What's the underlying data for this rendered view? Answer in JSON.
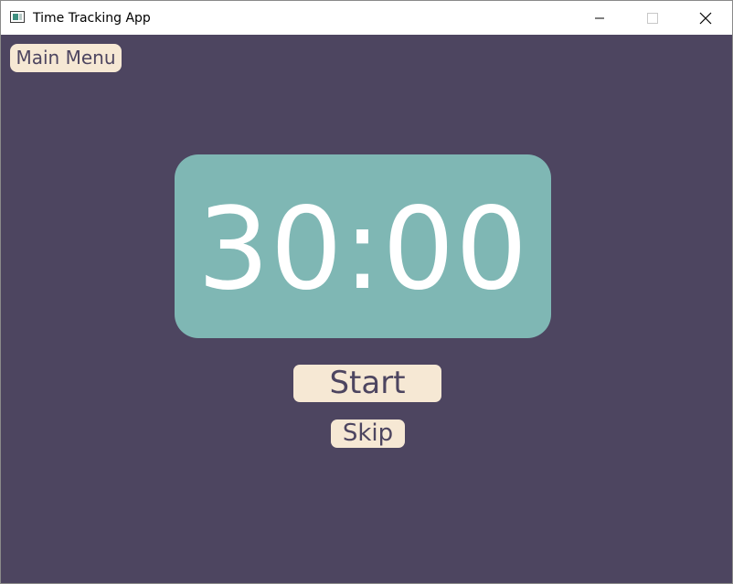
{
  "window": {
    "title": "Time Tracking App",
    "icons": {
      "app": "app-window-icon",
      "minimize": "minimize-icon",
      "maximize": "maximize-icon",
      "close": "close-icon"
    }
  },
  "toolbar": {
    "main_menu_label": "Main Menu"
  },
  "timer": {
    "display": "30:00"
  },
  "controls": {
    "start_label": "Start",
    "skip_label": "Skip"
  },
  "colors": {
    "background": "#4d4560",
    "timer_panel": "#7fb7b4",
    "button": "#f6e8d4",
    "button_text": "#4d4560",
    "timer_text": "#ffffff"
  }
}
